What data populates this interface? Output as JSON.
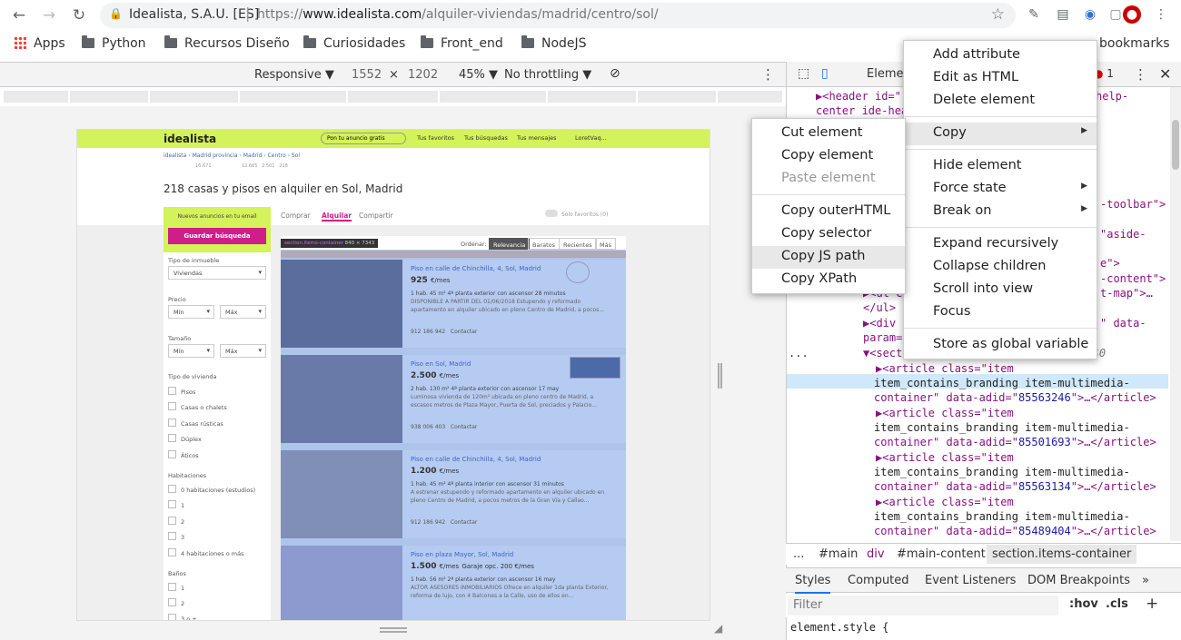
{
  "browser": {
    "site_identity": "Idealista, S.A.U. [ES]",
    "url_prefix": "https://",
    "url_host": "www.idealista.com",
    "url_path": "/alquiler-viviendas/madrid/centro/sol/",
    "back_icon": "←",
    "forward_icon": "→",
    "reload_icon": "↻",
    "star_icon": "☆",
    "menu_icon": "⋮"
  },
  "bookmarks": {
    "apps": "Apps",
    "items": [
      "Python",
      "Recursos Diseño",
      "Curiosidades",
      "Front_end",
      "NodeJS"
    ],
    "other": "bookmarks"
  },
  "device_toolbar": {
    "mode": "Responsive ▼",
    "width": "1552",
    "times": "×",
    "height": "1202",
    "zoom": "45% ▼",
    "throttle": "No throttling ▼"
  },
  "page": {
    "logo": "idealista",
    "anuncio": "Pon tu anuncio gratis",
    "header_links": [
      "Tus favoritos",
      "Tus búsquedas",
      "Tus mensajes",
      "LoretVaq..."
    ],
    "breadcrumb": [
      "idealista",
      "Madrid provincia",
      "Madrid",
      "Centro",
      "Sol"
    ],
    "breadcrumb_counts": [
      "16.671",
      "12.665",
      "2.501",
      "218"
    ],
    "title": "218 casas y pisos en alquiler en Sol, Madrid",
    "email_note": "Nuevos anuncios en tu email",
    "save_search": "Guardar búsqueda",
    "tabs": [
      "Comprar",
      "Alquilar",
      "Compartir"
    ],
    "solo_favoritos": "Solo favoritos (0)",
    "order_label": "Ordenar:",
    "order_options": [
      "Relevancia",
      "Baratos",
      "Recientes",
      "Más"
    ],
    "tooltip_name": "section.items-container",
    "tooltip_size": "840 × 7343",
    "filters": {
      "tipo_inmueble_label": "Tipo de inmueble",
      "tipo_inmueble_value": "Viviendas",
      "precio_label": "Precio",
      "min": "Mín",
      "max": "Máx",
      "tamano_label": "Tamaño",
      "tipo_vivienda_label": "Tipo de vivienda",
      "tipo_vivienda": [
        "Pisos",
        "Casas o chalets",
        "Casas rústicas",
        "Dúplex",
        "Áticos"
      ],
      "habitaciones_label": "Habitaciones",
      "habitaciones": [
        "0 habitaciones (estudios)",
        "1",
        "2",
        "3",
        "4 habitaciones o más"
      ],
      "banos_label": "Baños",
      "banos": [
        "1",
        "2",
        "3 o +"
      ]
    },
    "listings": [
      {
        "title": "Piso en calle de Chinchilla, 4, Sol, Madrid",
        "price": "925",
        "unit": "€/mes",
        "details": "1 hab.  45 m²  4ª planta exterior con ascensor  28 minutos",
        "desc": "DISPONIBLE A PARTIR DEL 01/06/2018 Estupendo y reformado apartamento en alquiler ubicado en pleno Centro de Madrid, a pocos...",
        "phone": "912 186 942",
        "contact": "Contactar"
      },
      {
        "title": "Piso en Sol, Madrid",
        "price": "2.500",
        "unit": "€/mes",
        "details": "2 hab.  130 m²  4ª planta exterior con ascensor  17 may",
        "desc": "Luminosa vivienda de 120m² ubicada en pleno centro de Madrid, a escasos metros de Plaza Mayor, Puerta de Sol, preciados y Palacio...",
        "phone": "938 006 403",
        "contact": "Contactar"
      },
      {
        "title": "Piso en calle de Chinchilla, 4, Sol, Madrid",
        "price": "1.200",
        "unit": "€/mes",
        "details": "1 hab.  45 m²  4ª planta interior con ascensor  31 minutos",
        "desc": "A estrenar estupendo y reformado apartamento en alquiler ubicado en pleno Centro de Madrid, a pocos metros de la Gran Vía y Callao...",
        "phone": "912 186 942",
        "contact": "Contactar"
      },
      {
        "title": "Piso en plaza Mayor, Sol, Madrid",
        "price": "1.500",
        "unit": "€/mes",
        "extra": "Garaje opc. 200 €/mes",
        "details": "1 hab.  56 m²  2ª planta exterior con ascensor  16 may",
        "desc": "ALTOR ASESORES INMOBILIARIOS Ofrece en alquiler 1da planta Exterior, reforma de lujo, con 4 Balcones a la Calle, uso de ellos en...",
        "phone": "",
        "contact": ""
      }
    ]
  },
  "devtools": {
    "elements_tab": "Element",
    "error_count": "1",
    "dom_lines": [
      {
        "indent": 1,
        "html": "▶<header id=\"",
        "attr": "help-"
      },
      {
        "indent": 0,
        "html": "center ide-hea",
        "attr": ""
      },
      {
        "indent": 0,
        "html": "",
        "attr": ""
      },
      {
        "indent": 0,
        "html": "",
        "attr": ""
      },
      {
        "indent": 0,
        "html": "",
        "attr": "-toolbar\">"
      },
      {
        "indent": 0,
        "html": "",
        "attr": ""
      },
      {
        "indent": 0,
        "html": "",
        "attr": "\"aside-"
      },
      {
        "indent": 0,
        "html": "",
        "attr": ""
      },
      {
        "indent": 0,
        "html": "",
        "attr": "e\">"
      },
      {
        "indent": 0,
        "html": "",
        "attr": ""
      },
      {
        "indent": 0,
        "html": "",
        "attr": "-content\">"
      },
      {
        "indent": 0,
        "html": "▶<ul c",
        "attr": "t-map\">…"
      },
      {
        "indent": 0,
        "html": "</ul>",
        "attr": ""
      },
      {
        "indent": 0,
        "html": "▶<div",
        "attr": "\" data-"
      },
      {
        "indent": 0,
        "html": "param=",
        "attr": ""
      }
    ],
    "selected_line": "▼<sect",
    "selected_suffix": "== $0",
    "ellipsis": "...",
    "articles": [
      {
        "adid": "85563246"
      },
      {
        "adid": "85501693"
      },
      {
        "adid": "85563134"
      },
      {
        "adid": "85489404"
      }
    ],
    "article_line1": "▶<article class=\"item",
    "article_line2": "item_contains_branding item-multimedia-",
    "article_line3_pre": "container\" data-adid=\"",
    "article_line3_post": "\">…</article>",
    "breadcrumbs": [
      "...",
      "#main",
      "div",
      "#main-content",
      "section.items-container"
    ],
    "styles_tabs": [
      "Styles",
      "Computed",
      "Event Listeners",
      "DOM Breakpoints",
      "»"
    ],
    "filter_placeholder": "Filter",
    "hov": ":hov",
    "cls": ".cls",
    "plus": "+",
    "element_style": "element.style {"
  },
  "context_menu": {
    "items": [
      "Add attribute",
      "Edit as HTML",
      "Delete element",
      "Copy",
      "Hide element",
      "Force state",
      "Break on",
      "Expand recursively",
      "Collapse children",
      "Scroll into view",
      "Focus",
      "Store as global variable"
    ]
  },
  "copy_submenu": {
    "items": [
      "Cut element",
      "Copy element",
      "Paste element",
      "Copy outerHTML",
      "Copy selector",
      "Copy JS path",
      "Copy XPath"
    ],
    "highlighted": "Copy JS path"
  }
}
